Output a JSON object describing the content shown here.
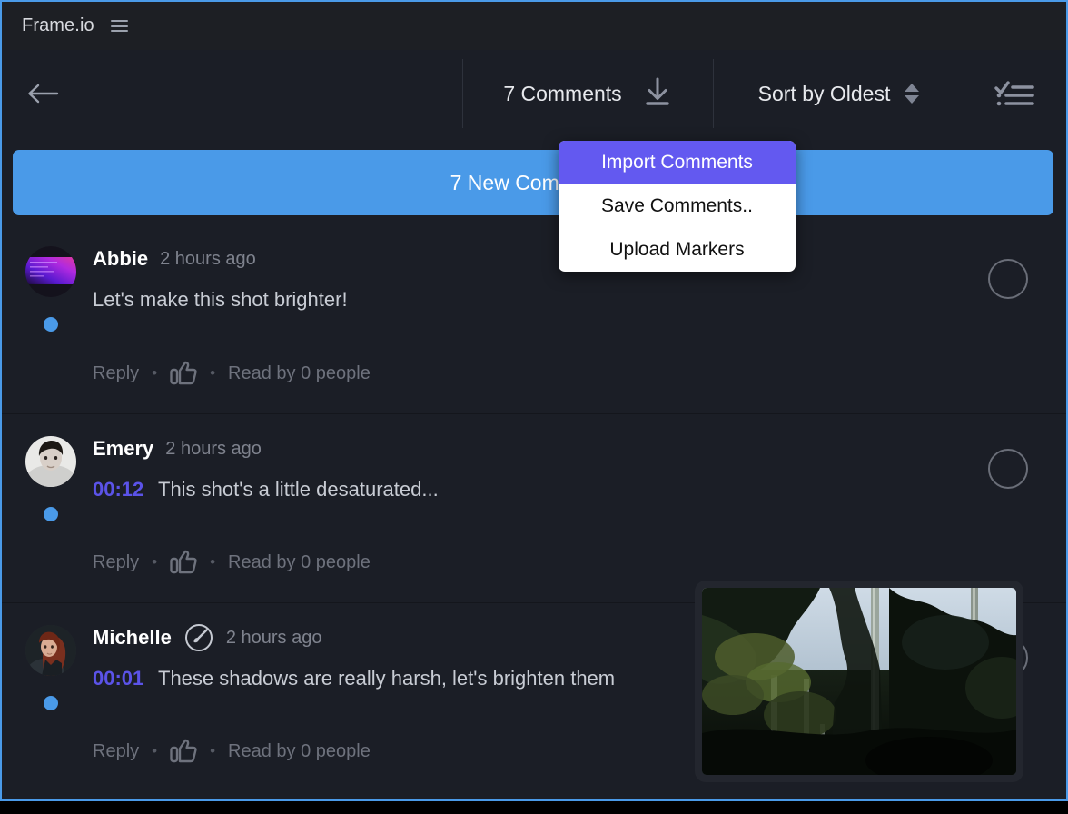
{
  "window": {
    "accent_border_color": "#4a9ae8",
    "background_color": "#1b1e26"
  },
  "title_bar": {
    "app_title": "Frame.io",
    "menu_icon": "hamburger-icon"
  },
  "toolbar": {
    "back_icon": "back-arrow-icon",
    "comments_count_label": "7 Comments",
    "download_icon": "download-icon",
    "sort_label": "Sort by Oldest",
    "sort_arrows_icon": "sort-arrows-icon",
    "checklist_icon": "checklist-icon"
  },
  "banner": {
    "label": "7 New Comments",
    "color": "#4a9ae8"
  },
  "dropdown_menu": {
    "items": [
      {
        "label": "Import Comments",
        "active": true
      },
      {
        "label": "Save Comments..",
        "active": false
      },
      {
        "label": "Upload Markers",
        "active": false
      }
    ],
    "highlight_color": "#6359f0"
  },
  "comments": [
    {
      "author": "Abbie",
      "time_ago": "2 hours ago",
      "timestamp": "",
      "text": "Let's make this shot brighter!",
      "reply_label": "Reply",
      "read_by": "Read by 0 people",
      "like_icon": "thumbs-up-icon",
      "badge": "",
      "avatar_type": "gradient",
      "unread": true
    },
    {
      "author": "Emery",
      "time_ago": "2 hours ago",
      "timestamp": "00:12",
      "text": "This shot's a little desaturated...",
      "reply_label": "Reply",
      "read_by": "Read by 0 people",
      "like_icon": "thumbs-up-icon",
      "badge": "",
      "avatar_type": "photo-man",
      "unread": true
    },
    {
      "author": "Michelle",
      "time_ago": "2 hours ago",
      "timestamp": "00:01",
      "text": "These shadows are really harsh, let's brighten them",
      "reply_label": "Reply",
      "read_by": "Read by 0 people",
      "like_icon": "thumbs-up-icon",
      "badge": "brush-badge-icon",
      "avatar_type": "photo-woman",
      "unread": true
    }
  ],
  "video_thumbnail": {
    "name": "forest-thumbnail",
    "description": "Dark forest with tall trees and bright sky"
  },
  "colors": {
    "timestamp_link": "#5b53e8",
    "unread_dot": "#4a9ae8",
    "muted_text": "#7f838e"
  }
}
